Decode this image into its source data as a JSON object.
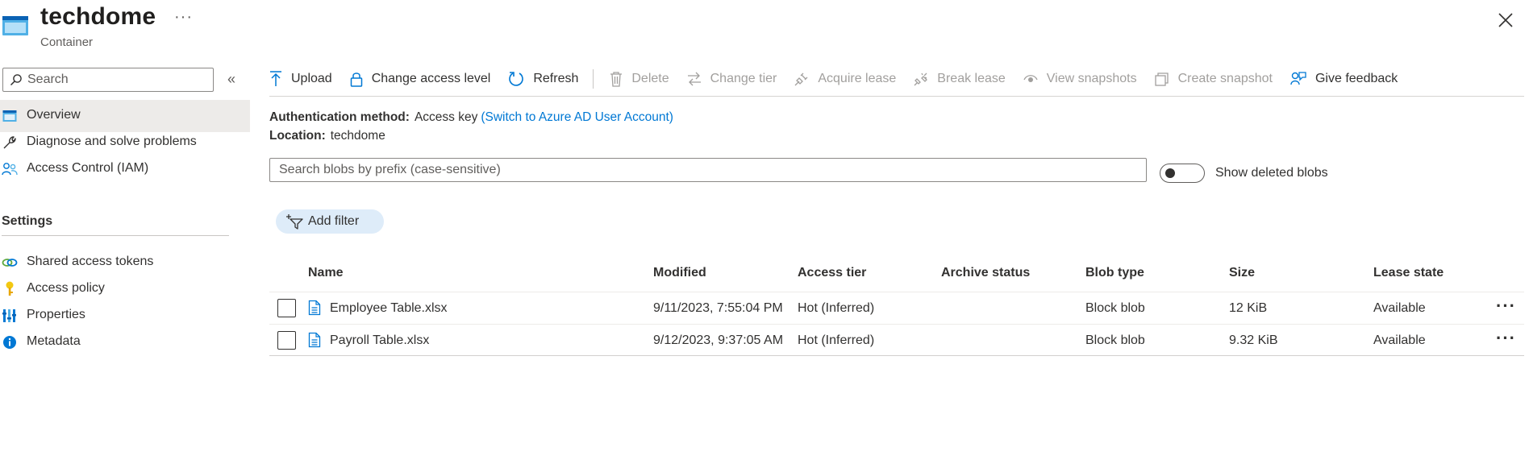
{
  "header": {
    "title": "techdome",
    "subtitle": "Container",
    "more": "···"
  },
  "sidebar": {
    "search_placeholder": "Search",
    "collapse": "«",
    "items": [
      {
        "label": "Overview",
        "icon": "container-icon"
      },
      {
        "label": "Diagnose and solve problems",
        "icon": "wrench-icon"
      },
      {
        "label": "Access Control (IAM)",
        "icon": "people-icon"
      }
    ],
    "settings_label": "Settings",
    "settings_items": [
      {
        "label": "Shared access tokens",
        "icon": "link-icon"
      },
      {
        "label": "Access policy",
        "icon": "key-icon"
      },
      {
        "label": "Properties",
        "icon": "properties-icon"
      },
      {
        "label": "Metadata",
        "icon": "info-icon"
      }
    ]
  },
  "toolbar": {
    "upload": "Upload",
    "change_access_level": "Change access level",
    "refresh": "Refresh",
    "delete": "Delete",
    "change_tier": "Change tier",
    "acquire_lease": "Acquire lease",
    "break_lease": "Break lease",
    "view_snapshots": "View snapshots",
    "create_snapshot": "Create snapshot",
    "give_feedback": "Give feedback"
  },
  "info": {
    "auth_label": "Authentication method:",
    "auth_value": "Access key",
    "auth_link": "(Switch to Azure AD User Account)",
    "location_label": "Location:",
    "location_value": "techdome"
  },
  "blob_search": {
    "placeholder": "Search blobs by prefix (case-sensitive)"
  },
  "show_deleted": {
    "label": "Show deleted blobs",
    "on": false
  },
  "filter": {
    "add_filter": "Add filter"
  },
  "table": {
    "columns": [
      "Name",
      "Modified",
      "Access tier",
      "Archive status",
      "Blob type",
      "Size",
      "Lease state"
    ],
    "rows": [
      {
        "name": "Employee Table.xlsx",
        "modified": "9/11/2023, 7:55:04 PM",
        "access_tier": "Hot (Inferred)",
        "archive_status": "",
        "blob_type": "Block blob",
        "size": "12 KiB",
        "lease_state": "Available"
      },
      {
        "name": "Payroll Table.xlsx",
        "modified": "9/12/2023, 9:37:05 AM",
        "access_tier": "Hot (Inferred)",
        "archive_status": "",
        "blob_type": "Block blob",
        "size": "9.32 KiB",
        "lease_state": "Available"
      }
    ],
    "row_more": "···"
  },
  "colors": {
    "accent": "#0078d4",
    "selected_bg": "#edebe9",
    "pill_bg": "#deecf9",
    "disabled_text": "#a19f9d"
  }
}
